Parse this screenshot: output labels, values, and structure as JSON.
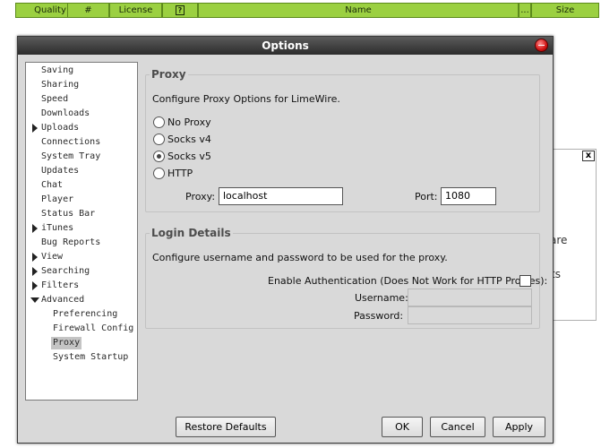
{
  "columns": [
    {
      "label": "Quality"
    },
    {
      "label": "#"
    },
    {
      "label": "License"
    },
    {
      "label": "?"
    },
    {
      "label": "Name"
    },
    {
      "label": "..."
    },
    {
      "label": "Size"
    }
  ],
  "background_panel": {
    "close_label": "x",
    "text1": "are",
    "text2": "ts"
  },
  "dialog": {
    "title": "Options"
  },
  "tree": {
    "items": [
      {
        "label": "Saving"
      },
      {
        "label": "Sharing"
      },
      {
        "label": "Speed"
      },
      {
        "label": "Downloads"
      },
      {
        "label": "Uploads"
      },
      {
        "label": "Connections"
      },
      {
        "label": "System Tray"
      },
      {
        "label": "Updates"
      },
      {
        "label": "Chat"
      },
      {
        "label": "Player"
      },
      {
        "label": "Status Bar"
      },
      {
        "label": "iTunes"
      },
      {
        "label": "Bug Reports"
      },
      {
        "label": "View"
      },
      {
        "label": "Searching"
      },
      {
        "label": "Filters"
      },
      {
        "label": "Advanced"
      },
      {
        "label": "Preferencing"
      },
      {
        "label": "Firewall Config"
      },
      {
        "label": "Proxy"
      },
      {
        "label": "System Startup"
      }
    ]
  },
  "proxy": {
    "title": "Proxy",
    "description": "Configure Proxy Options for LimeWire.",
    "options": [
      {
        "label": "No Proxy"
      },
      {
        "label": "Socks v4"
      },
      {
        "label": "Socks v5"
      },
      {
        "label": "HTTP"
      }
    ],
    "selected": "Socks v5",
    "proxy_label": "Proxy:",
    "proxy_value": "localhost",
    "port_label": "Port:",
    "port_value": "1080"
  },
  "login": {
    "title": "Login Details",
    "description": "Configure username and password to be used for the proxy.",
    "auth_label": "Enable Authentication (Does Not Work for HTTP Proxies):",
    "username_label": "Username:",
    "password_label": "Password:"
  },
  "buttons": {
    "restore": "Restore Defaults",
    "ok": "OK",
    "cancel": "Cancel",
    "apply": "Apply"
  },
  "colors": {
    "header_green": "#9bd041",
    "title_dark": "#2c2c2c",
    "close_red": "#d21414"
  }
}
